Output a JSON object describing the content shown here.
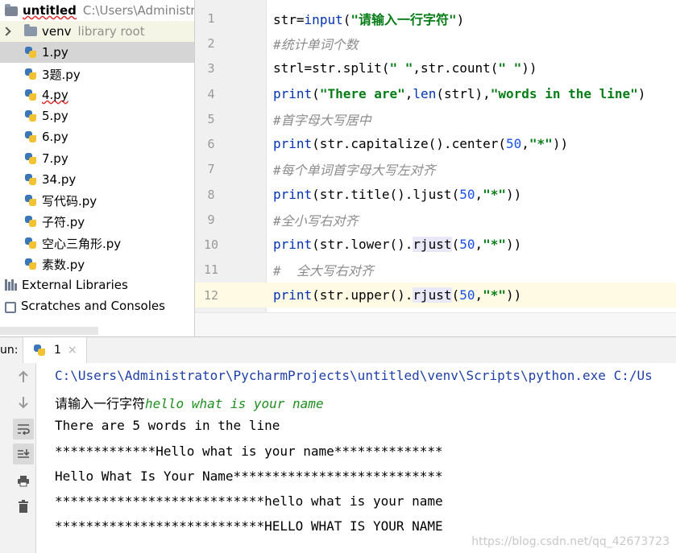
{
  "project": {
    "root_name": "untitled",
    "root_path": "C:\\Users\\Administrat",
    "venv": {
      "name": "venv",
      "hint": "library root"
    },
    "files": [
      "1.py",
      "3题.py",
      "4.py",
      "5.py",
      "6.py",
      "7.py",
      "34.py",
      "写代码.py",
      "子符.py",
      "空心三角形.py",
      "素数.py"
    ],
    "selected_file": "1.py",
    "external_libraries": "External Libraries",
    "scratches": "Scratches and Consoles"
  },
  "editor": {
    "line_numbers": [
      "1",
      "2",
      "3",
      "4",
      "5",
      "6",
      "7",
      "8",
      "9",
      "10",
      "11",
      "12"
    ],
    "current_line": "12",
    "code": {
      "l1_str": "str",
      "l1_eq": "=",
      "l1_fn": "input",
      "l1_open": "(",
      "l1_s": "\"请输入一行字符\"",
      "l1_close": ")",
      "l2_comment": "#统计单词个数",
      "l3_a": "strl=str.split(",
      "l3_s1": "\" \"",
      "l3_b": ",str.count(",
      "l3_s2": "\" \"",
      "l3_c": "))",
      "l4_fn": "print",
      "l4_open": "(",
      "l4_s1": "\"There are\"",
      "l4_comma": ",",
      "l4_len": "len",
      "l4_arg": "(strl),",
      "l4_s2": "\"words in the line\"",
      "l4_close": ")",
      "l5_comment": "#首字母大写居中",
      "l6_fn": "print",
      "l6_a": "(str.capitalize().center(",
      "l6_num": "50",
      "l6_comma": ",",
      "l6_s": "\"*\"",
      "l6_close": "))",
      "l7_comment": "#每个单词首字母大写左对齐",
      "l8_fn": "print",
      "l8_a": "(str.title().ljust(",
      "l8_num": "50",
      "l8_comma": ",",
      "l8_s": "\"*\"",
      "l8_close": "))",
      "l9_comment": "#全小写右对齐",
      "l10_fn": "print",
      "l10_a": "(str.lower().",
      "l10_hl": "rjust",
      "l10_open": "(",
      "l10_num": "50",
      "l10_comma": ",",
      "l10_s": "\"*\"",
      "l10_close": "))",
      "l11_comment": "#  全大写右对齐",
      "l12_fn": "print",
      "l12_a": "(str.upper().",
      "l12_hl": "rjust",
      "l12_open": "(",
      "l12_num": "50",
      "l12_comma": ",",
      "l12_s": "\"*\"",
      "l12_close": "))"
    }
  },
  "run": {
    "label": "un:",
    "tab_label": "1",
    "close_glyph": "×",
    "toolbar_icons": [
      "arrow-up-icon",
      "arrow-down-icon",
      "soft-wrap-icon",
      "scroll-to-end-icon",
      "print-icon",
      "trash-icon"
    ],
    "console": {
      "command": "C:\\Users\\Administrator\\PycharmProjects\\untitled\\venv\\Scripts\\python.exe C:/Us",
      "prompt": "请输入一行字符",
      "user_input": "hello what is your name",
      "out1": "There are 5 words in the line",
      "out2": "*************Hello what is your name**************",
      "out3": "Hello What Is Your Name***************************",
      "out4": "***************************hello what is your name",
      "out5": "***************************HELLO WHAT IS YOUR NAME"
    },
    "watermark": "https://blog.csdn.net/qq_42673723"
  },
  "colors": {
    "string": "#067d17",
    "comment": "#8c8c8c",
    "keyword_fn": "#0033b3",
    "number": "#1750eb",
    "current_line": "#fffae3",
    "selected_row": "#d5d5d5"
  }
}
